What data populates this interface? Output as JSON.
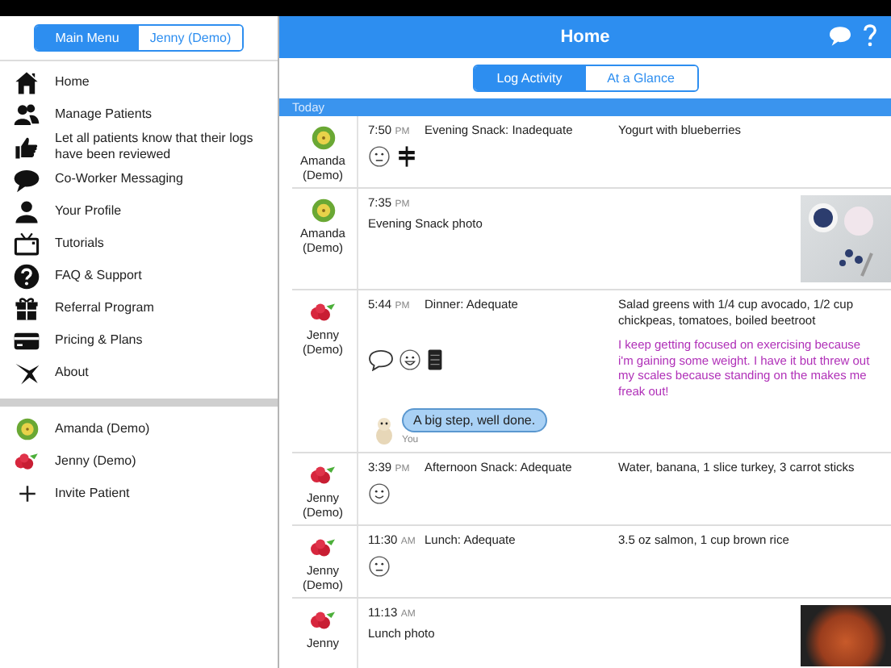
{
  "sidebar": {
    "tabs": [
      {
        "label": "Main Menu",
        "selected": true
      },
      {
        "label": "Jenny (Demo)",
        "selected": false
      }
    ],
    "menu": [
      {
        "label": "Home"
      },
      {
        "label": "Manage Patients"
      },
      {
        "label": "Let all patients know that their logs have been reviewed"
      },
      {
        "label": "Co-Worker Messaging"
      },
      {
        "label": "Your Profile"
      },
      {
        "label": "Tutorials"
      },
      {
        "label": "FAQ & Support"
      },
      {
        "label": "Referral Program"
      },
      {
        "label": "Pricing & Plans"
      },
      {
        "label": "About"
      }
    ],
    "patients": [
      {
        "kind": "kiwi",
        "label": "Amanda (Demo)"
      },
      {
        "kind": "raspberry",
        "label": "Jenny (Demo)"
      },
      {
        "kind": "plus",
        "label": "Invite Patient"
      }
    ]
  },
  "header": {
    "title": "Home"
  },
  "tabs": [
    {
      "label": "Log Activity",
      "selected": true
    },
    {
      "label": "At a Glance",
      "selected": false
    }
  ],
  "section": "Today",
  "entries": [
    {
      "kind": "kiwi",
      "name": "Amanda (Demo)",
      "time": "7:50",
      "meridiem": "PM",
      "title": "Evening Snack: Inadequate",
      "description": "Yogurt with blueberries",
      "icons": [
        {
          "kind": "neutral"
        },
        {
          "kind": "signpost"
        }
      ]
    },
    {
      "kind": "kiwi",
      "name": "Amanda (Demo)",
      "time": "7:35",
      "meridiem": "PM",
      "title": "Evening Snack photo",
      "photo": true
    },
    {
      "kind": "raspberry",
      "name": "Jenny (Demo)",
      "time": "5:44",
      "meridiem": "PM",
      "title": "Dinner: Adequate",
      "description": "Salad greens with 1/4 cup avocado, 1/2 cup chickpeas, tomatoes, boiled beetroot",
      "icons": [
        {
          "kind": "chat"
        },
        {
          "kind": "grin"
        },
        {
          "kind": "notebook"
        }
      ],
      "note": "I keep getting focused on exercising because i'm gaining some weight. I have it but threw out my scales because standing on the makes me freak out!",
      "comment": {
        "text": "A big step, well done.",
        "author": "You"
      }
    },
    {
      "kind": "raspberry",
      "name": "Jenny (Demo)",
      "time": "3:39",
      "meridiem": "PM",
      "title": "Afternoon Snack: Adequate",
      "description": "Water, banana, 1 slice turkey, 3 carrot sticks",
      "icons": [
        {
          "kind": "smile"
        }
      ]
    },
    {
      "kind": "raspberry",
      "name": "Jenny (Demo)",
      "time": "11:30",
      "meridiem": "AM",
      "title": "Lunch: Adequate",
      "description": "3.5 oz salmon, 1 cup brown rice",
      "icons": [
        {
          "kind": "neutral"
        }
      ]
    },
    {
      "kind": "raspberry",
      "name": "Jenny",
      "time": "11:13",
      "meridiem": "AM",
      "title": "Lunch photo",
      "photo": true
    }
  ]
}
